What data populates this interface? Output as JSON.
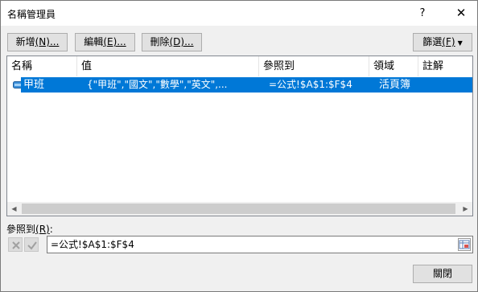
{
  "window": {
    "title": "名稱管理員",
    "help_label": "?",
    "close_glyph": "✕"
  },
  "toolbar": {
    "new_label": "新增",
    "new_key": "(N)...",
    "edit_label": "編輯",
    "edit_key": "(E)...",
    "delete_label": "刪除",
    "delete_key": "(D)...",
    "filter_label": "篩選",
    "filter_key": "(F)"
  },
  "table": {
    "columns": [
      "名稱",
      "值",
      "參照到",
      "領域",
      "註解"
    ],
    "rows": [
      {
        "name": "甲班",
        "value": "{\"甲班\",\"國文\",\"數學\",\"英文\",...",
        "refers_to": "=公式!$A$1:$F$4",
        "scope": "活頁簿",
        "comment": "",
        "selected": true,
        "icon": "named-range-icon"
      }
    ]
  },
  "refers_to": {
    "label": "參照到",
    "key": "(R)",
    "suffix": ":",
    "value": "=公式!$A$1:$F$4"
  },
  "footer": {
    "close_label": "關閉"
  },
  "colors": {
    "selection": "#0078d7",
    "dialog_bg": "#f0f0f0"
  }
}
